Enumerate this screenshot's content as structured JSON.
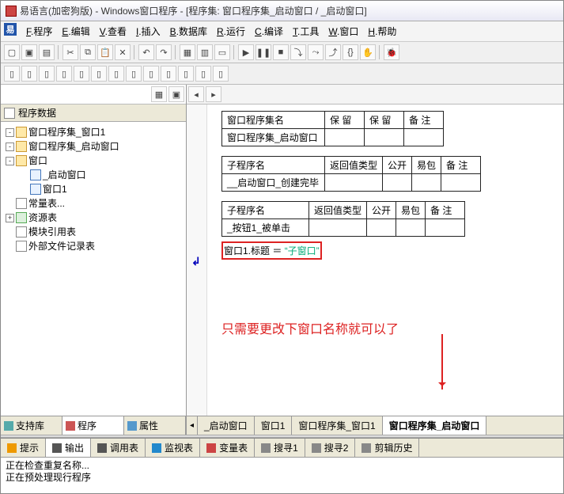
{
  "title": "易语言(加密狗版) - Windows窗口程序 - [程序集: 窗口程序集_启动窗口 / _启动窗口]",
  "menu": {
    "items": [
      "F.程序",
      "E.编辑",
      "V.查看",
      "I.插入",
      "B.数据库",
      "R.运行",
      "C.编译",
      "T.工具",
      "W.窗口",
      "H.帮助"
    ]
  },
  "sidebar": {
    "header": "程序数据",
    "tree": [
      {
        "depth": 0,
        "exp": "-",
        "icon": "folder",
        "label": "窗口程序集_窗口1"
      },
      {
        "depth": 0,
        "exp": "-",
        "icon": "folder",
        "label": "窗口程序集_启动窗口"
      },
      {
        "depth": 0,
        "exp": "-",
        "icon": "folder",
        "label": "窗口"
      },
      {
        "depth": 1,
        "exp": "",
        "icon": "window",
        "label": "_启动窗口"
      },
      {
        "depth": 1,
        "exp": "",
        "icon": "window",
        "label": "窗口1"
      },
      {
        "depth": 0,
        "exp": "",
        "icon": "table",
        "label": "常量表..."
      },
      {
        "depth": 0,
        "exp": "+",
        "icon": "res",
        "label": "资源表"
      },
      {
        "depth": 0,
        "exp": "",
        "icon": "table",
        "label": "模块引用表"
      },
      {
        "depth": 0,
        "exp": "",
        "icon": "table",
        "label": "外部文件记录表"
      }
    ],
    "bottom_tabs": [
      {
        "label": "支持库",
        "icon": "#5aa"
      },
      {
        "label": "程序",
        "icon": "#c55",
        "active": true
      },
      {
        "label": "属性",
        "icon": "#59c"
      }
    ]
  },
  "editor": {
    "tables": {
      "t1": {
        "headers": [
          "窗口程序集名",
          "保 留",
          "保 留",
          "备 注"
        ],
        "row": [
          "窗口程序集_启动窗口",
          "",
          "",
          ""
        ]
      },
      "t2": {
        "headers": [
          "子程序名",
          "返回值类型",
          "公开",
          "易包",
          "备 注"
        ],
        "row": [
          "__启动窗口_创建完毕",
          "",
          "",
          "",
          ""
        ]
      },
      "t3": {
        "headers": [
          "子程序名",
          "返回值类型",
          "公开",
          "易包",
          "备 注"
        ],
        "row": [
          "_按钮1_被单击",
          "",
          "",
          "",
          ""
        ]
      }
    },
    "code": {
      "lhs": "窗口1.标题",
      "op": " ＝ ",
      "rhs": "“子窗口”"
    },
    "annotation": "只需要更改下窗口名称就可以了",
    "tabs": [
      "_启动窗口",
      "窗口1",
      "窗口程序集_窗口1",
      "窗口程序集_启动窗口"
    ],
    "active_tab": 3
  },
  "bottom": {
    "tabs": [
      {
        "label": "提示",
        "icon": "#e90"
      },
      {
        "label": "输出",
        "icon": "#555",
        "active": true
      },
      {
        "label": "调用表",
        "icon": "#555"
      },
      {
        "label": "监视表",
        "icon": "#28c"
      },
      {
        "label": "变量表",
        "icon": "#c44"
      },
      {
        "label": "搜寻1",
        "icon": "#888"
      },
      {
        "label": "搜寻2",
        "icon": "#888"
      },
      {
        "label": "剪辑历史",
        "icon": "#888"
      }
    ],
    "lines": [
      "正在检查重复名称...",
      "正在预处理现行程序"
    ]
  }
}
